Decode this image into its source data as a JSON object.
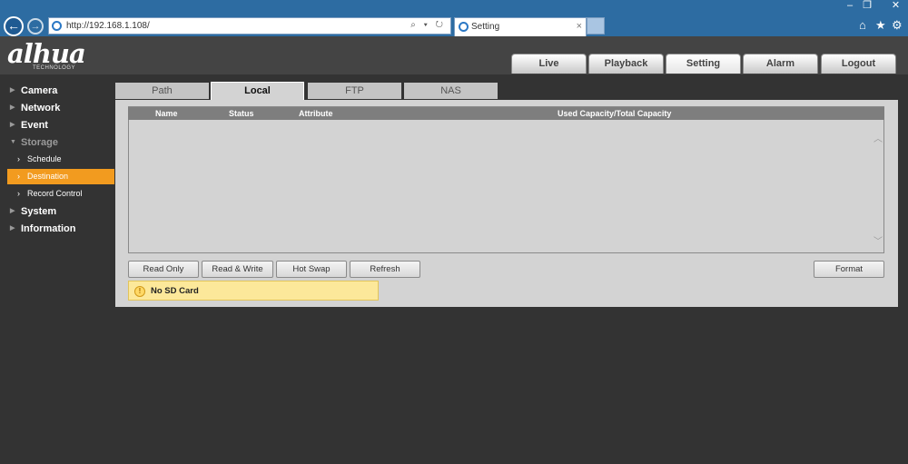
{
  "browser": {
    "url": "http://192.168.1.108/",
    "tab_title": "Setting",
    "tab_close": "×",
    "address_tools": "⌕ ▾ ↻",
    "window_controls": [
      "‒",
      "❐",
      "✕"
    ],
    "toolbar_icons": [
      "home-icon",
      "star-icon",
      "gear-icon"
    ]
  },
  "app": {
    "logo": "alhua",
    "logo_sub": "TECHNOLOGY",
    "top_tabs": [
      "Live",
      "Playback",
      "Setting",
      "Alarm",
      "Logout"
    ],
    "active_top_tab": "Setting",
    "accent_color": "#f29b1f"
  },
  "sidebar": {
    "items": [
      {
        "label": "Camera"
      },
      {
        "label": "Network"
      },
      {
        "label": "Event"
      },
      {
        "label": "Storage"
      },
      {
        "label": "System"
      },
      {
        "label": "Information"
      }
    ],
    "storage_subitems": [
      {
        "label": "Schedule"
      },
      {
        "label": "Destination"
      },
      {
        "label": "Record Control"
      }
    ],
    "active_subitem": "Destination"
  },
  "content": {
    "tabs": [
      "Path",
      "Local",
      "FTP",
      "NAS"
    ],
    "active_tab": "Local",
    "table": {
      "columns": [
        "Name",
        "Status",
        "Attribute",
        "Used Capacity/Total Capacity"
      ],
      "rows": []
    },
    "buttons": {
      "read_only": "Read Only",
      "read_write": "Read & Write",
      "hot_swap": "Hot Swap",
      "refresh": "Refresh",
      "format": "Format"
    },
    "notice": "No SD Card"
  }
}
